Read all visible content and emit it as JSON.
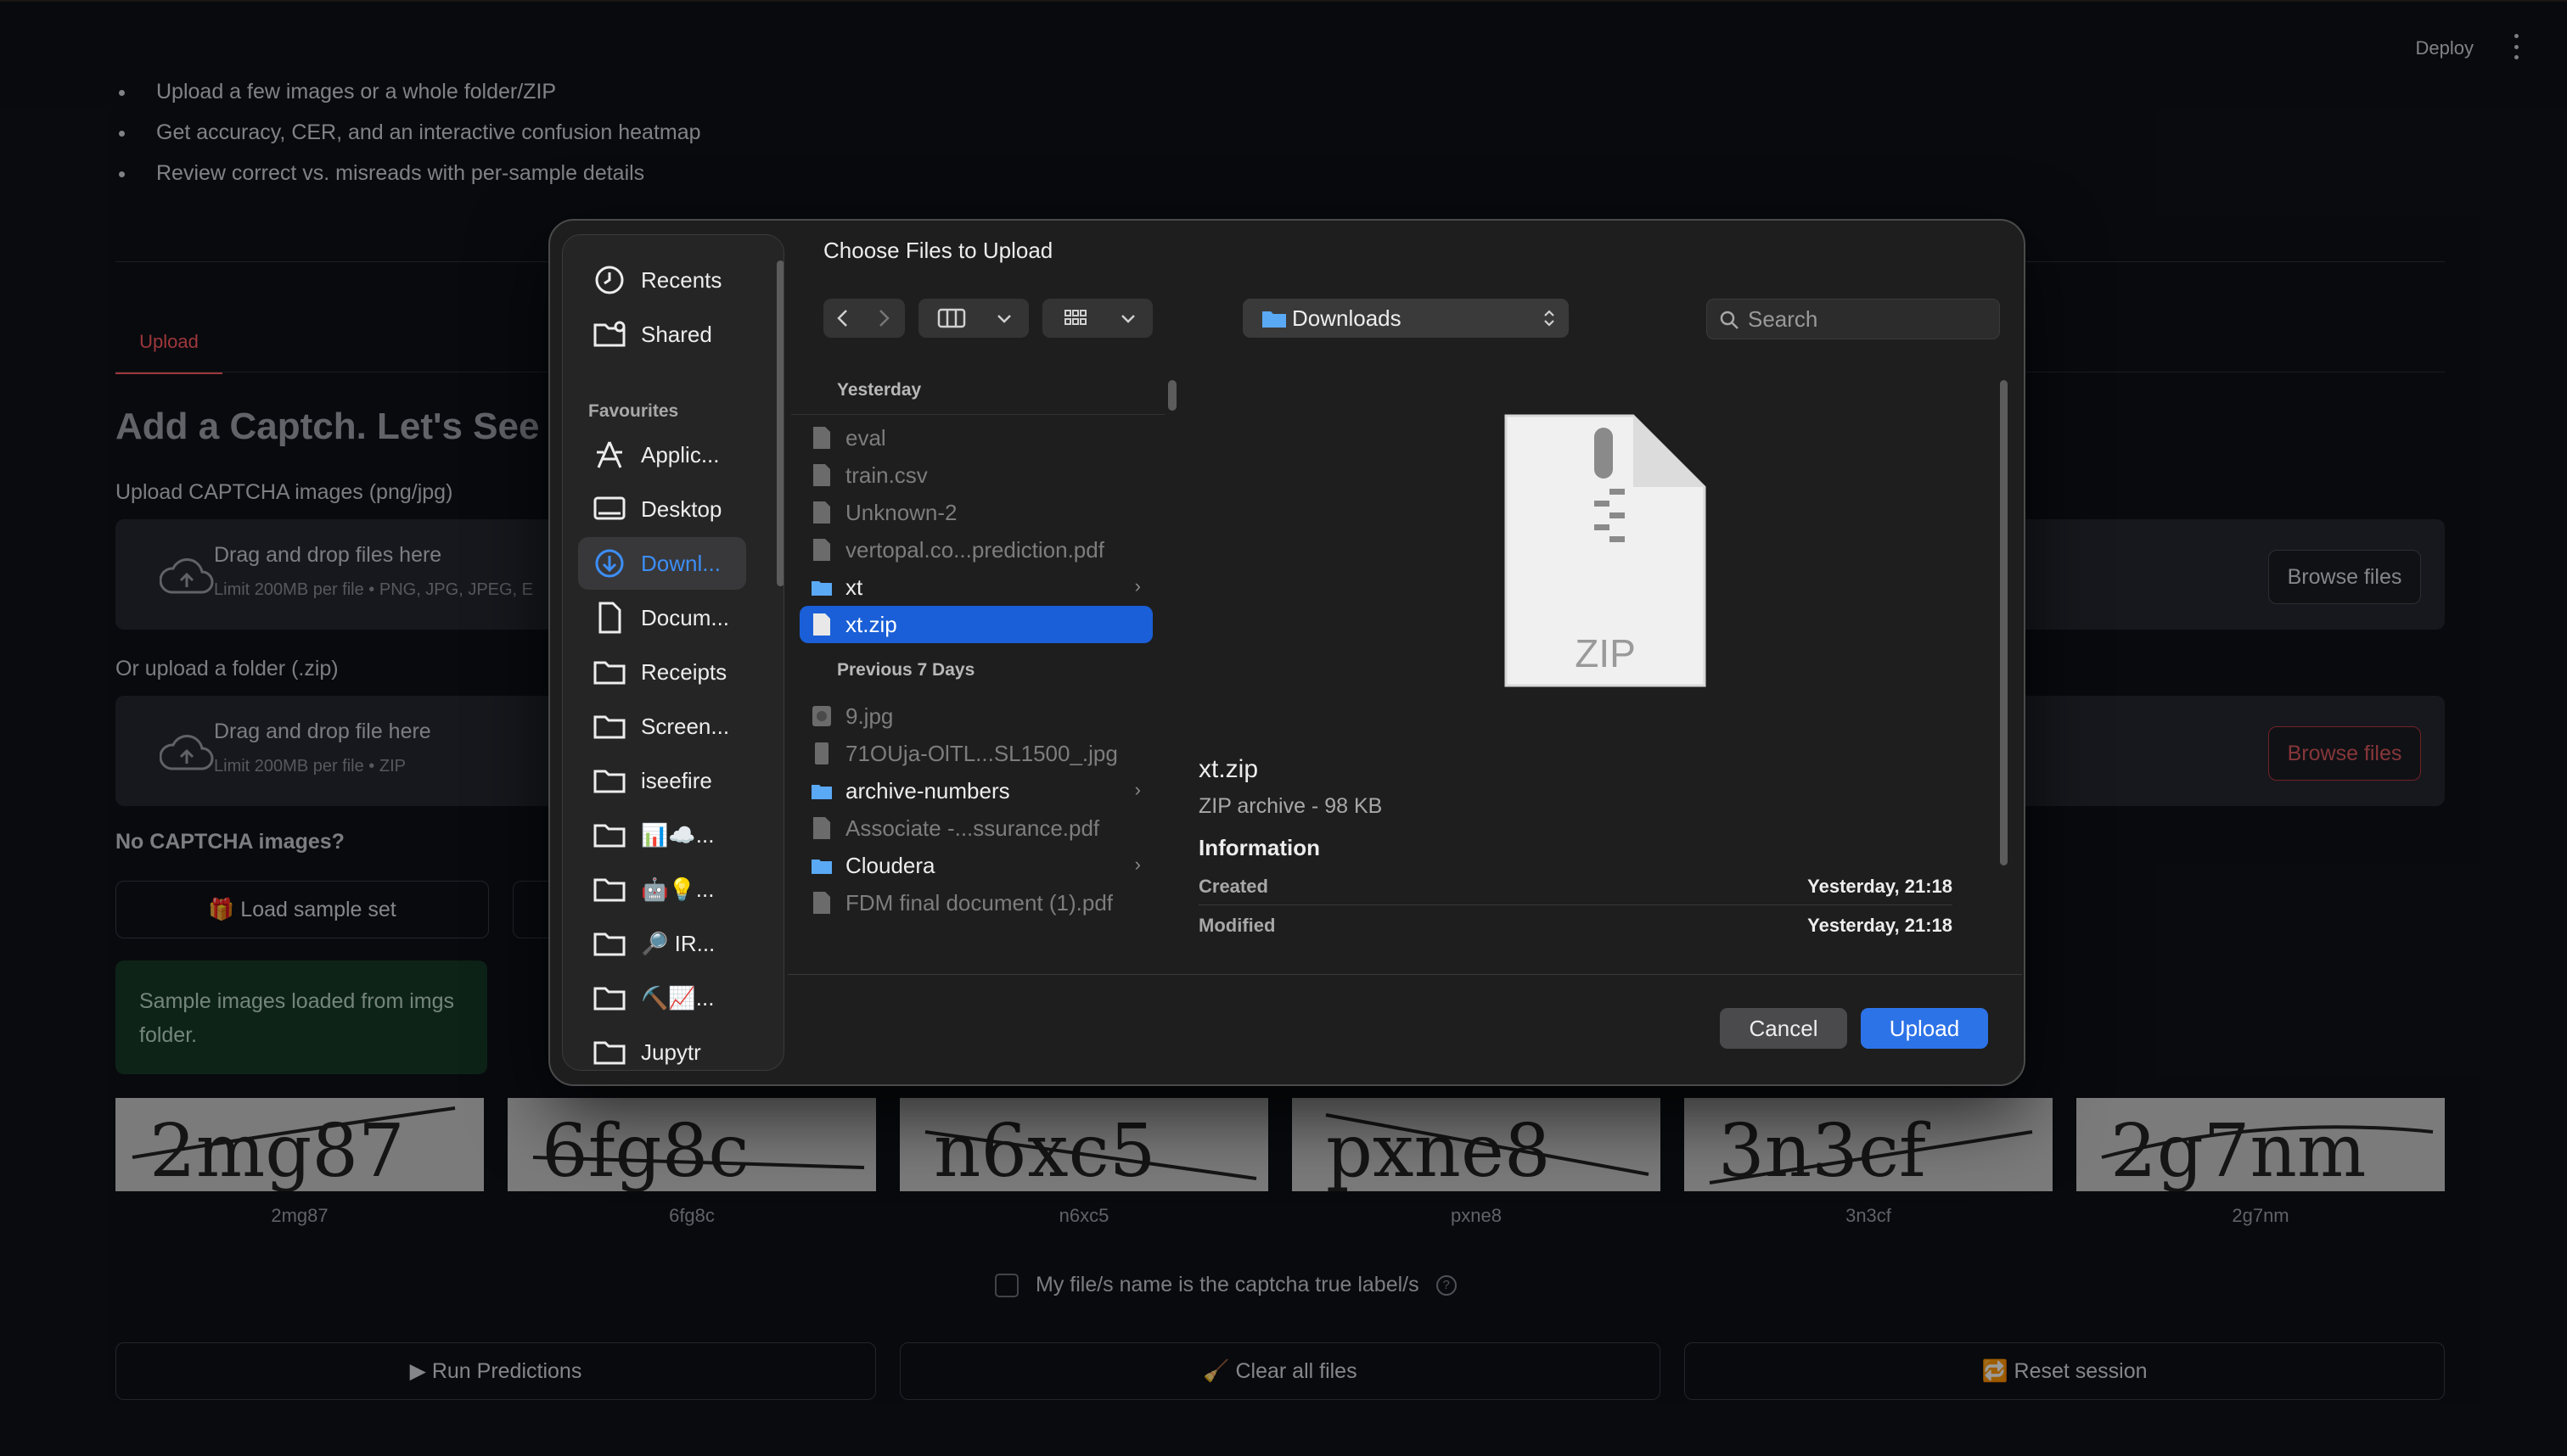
{
  "app": {
    "deploy_label": "Deploy",
    "bullets": [
      "Upload a few images or a whole folder/ZIP",
      "Get accuracy, CER, and an interactive confusion heatmap",
      "Review correct vs. misreads with per-sample details"
    ],
    "tab_upload": "Upload",
    "heading": "Add a Captch. Let's See Ho",
    "upload_images_label": "Upload CAPTCHA images (png/jpg)",
    "uploader1": {
      "title": "Drag and drop files here",
      "sub": "Limit 200MB per file • PNG, JPG, JPEG, E",
      "browse": "Browse files"
    },
    "upload_zip_label": "Or upload a folder (.zip)",
    "uploader2": {
      "title": "Drag and drop file here",
      "sub": "Limit 200MB per file • ZIP",
      "browse": "Browse files"
    },
    "no_captcha_label": "No CAPTCHA images?",
    "load_sample_label": "🎁 Load sample set",
    "success_msg": "Sample images loaded from imgs folder.",
    "captchas": [
      "2mg87",
      "6fg8c",
      "n6xc5",
      "pxne8",
      "3n3cf",
      "2g7nm"
    ],
    "checkbox_label": "My file/s name is the captcha true label/s",
    "help_glyph": "?",
    "run_label": "▶ Run Predictions",
    "clear_label": "🧹 Clear all files",
    "reset_label": "🔁 Reset session"
  },
  "dialog": {
    "title": "Choose Files to Upload",
    "location": "Downloads",
    "search_placeholder": "Search",
    "sidebar": {
      "top": [
        {
          "label": "Recents",
          "icon": "clock-icon"
        },
        {
          "label": "Shared",
          "icon": "shared-folder-icon"
        }
      ],
      "heading": "Favourites",
      "favourites": [
        {
          "label": "Applic...",
          "icon": "applications-icon"
        },
        {
          "label": "Desktop",
          "icon": "desktop-icon"
        },
        {
          "label": "Downl...",
          "icon": "downloads-icon",
          "active": true
        },
        {
          "label": "Docum...",
          "icon": "document-icon"
        },
        {
          "label": "Receipts",
          "icon": "folder-icon"
        },
        {
          "label": "Screen...",
          "icon": "folder-icon"
        },
        {
          "label": "iseefire",
          "icon": "folder-icon"
        },
        {
          "label": "📊☁️...",
          "icon": "folder-icon"
        },
        {
          "label": "🤖💡...",
          "icon": "folder-icon"
        },
        {
          "label": "🔎 IR...",
          "icon": "folder-icon"
        },
        {
          "label": "⛏️📈...",
          "icon": "folder-icon"
        },
        {
          "label": "Jupytr",
          "icon": "folder-icon"
        }
      ]
    },
    "groups": {
      "yesterday": "Yesterday",
      "previous7": "Previous 7 Days"
    },
    "files_yesterday": [
      {
        "name": "eval",
        "kind": "file"
      },
      {
        "name": "train.csv",
        "kind": "file"
      },
      {
        "name": "Unknown-2",
        "kind": "file"
      },
      {
        "name": "vertopal.co...prediction.pdf",
        "kind": "file"
      },
      {
        "name": "xt",
        "kind": "folder"
      },
      {
        "name": "xt.zip",
        "kind": "file",
        "selected": true
      }
    ],
    "files_previous": [
      {
        "name": "9.jpg",
        "kind": "image"
      },
      {
        "name": "71OUja-OlTL...SL1500_.jpg",
        "kind": "image"
      },
      {
        "name": "archive-numbers",
        "kind": "folder"
      },
      {
        "name": "Associate -...ssurance.pdf",
        "kind": "file"
      },
      {
        "name": "Cloudera",
        "kind": "folder"
      },
      {
        "name": "FDM final document (1).pdf",
        "kind": "file"
      }
    ],
    "preview": {
      "icon_text": "ZIP",
      "name": "xt.zip",
      "kind": "ZIP archive - 98 KB",
      "info_heading": "Information",
      "created_label": "Created",
      "created_value": "Yesterday, 21:18",
      "modified_label": "Modified",
      "modified_value": "Yesterday, 21:18"
    },
    "cancel_label": "Cancel",
    "upload_label": "Upload"
  },
  "colors": {
    "accent_red": "#ff5a5f",
    "selection_blue": "#1a5fd7",
    "upload_blue": "#2d73e8",
    "success_bg": "#173928"
  }
}
